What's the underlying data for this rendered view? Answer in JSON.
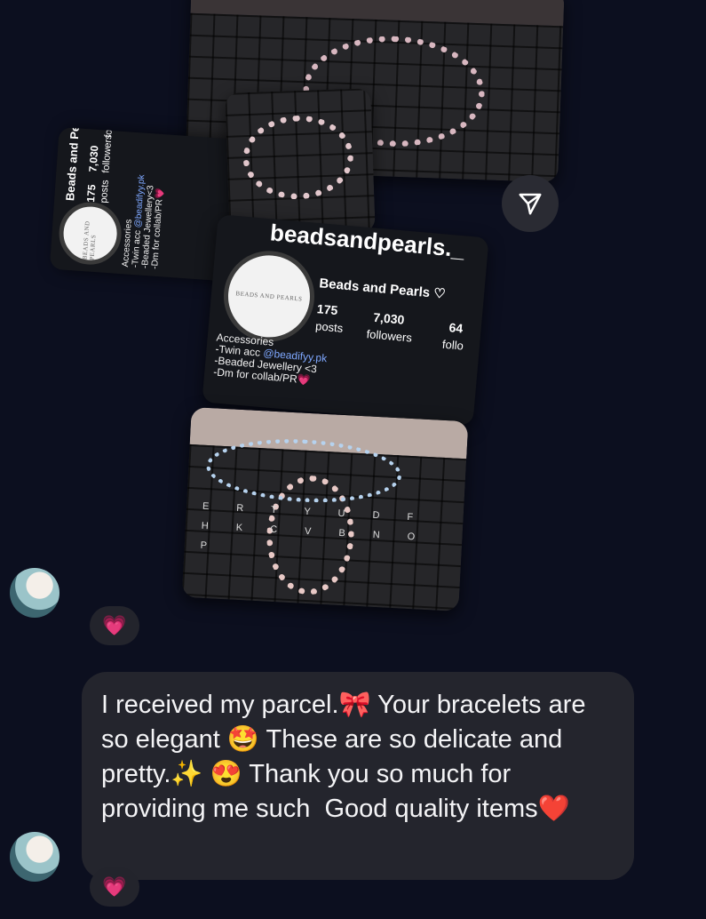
{
  "post": {
    "back_profile": {
      "display_name": "Beads and Pearls ♡",
      "posts_count": "175",
      "posts_label": "posts",
      "followers_count": "7,030",
      "followers_label": "followers",
      "following_partial": "fo",
      "category": "Accessories",
      "bio_1_prefix": "-Twin acc ",
      "bio_1_link": "@beadifyy.pk",
      "bio_2": "-Beaded Jewellery<3",
      "bio_3": "-Dm for collab/PR💗",
      "avatar_text": "BEADS AND PEARLS"
    },
    "front_profile": {
      "username": "beadsandpearls._",
      "display_name": "Beads and Pearls ♡",
      "posts_count": "175",
      "posts_label": "posts",
      "followers_count": "7,030",
      "followers_label": "followers",
      "following_count": "64",
      "following_partial": "follo",
      "category": "Accessories",
      "bio_1_prefix": "-Twin acc ",
      "bio_1_link": "@beadifyy.pk",
      "bio_2": "-Beaded Jewellery <3",
      "bio_3": "-Dm for collab/PR💗",
      "avatar_text": "BEADS AND PEARLS"
    },
    "keyboard_letters": [
      "E",
      "R",
      "T",
      "Y",
      "U",
      "D",
      "F",
      "H",
      "K",
      "C",
      "V",
      "B",
      "N",
      "O",
      "P"
    ]
  },
  "first_reaction": "💗",
  "message": {
    "text": "I received my parcel.🎀 Your bracelets are so elegant 🤩 These are so delicate and pretty.✨ 😍 Thank you so much for providing me such  Good quality items❤️"
  },
  "second_reaction": "💗",
  "colors": {
    "background": "#0c0f1f",
    "bubble": "#24252d",
    "link": "#7fa8ff"
  }
}
